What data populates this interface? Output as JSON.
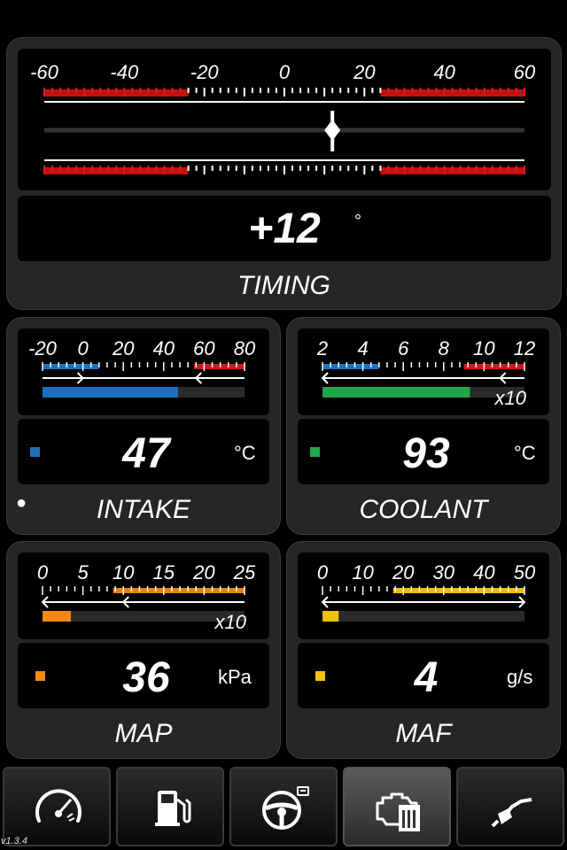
{
  "timing": {
    "title": "TIMING",
    "value": "+12",
    "unit": "°",
    "scale_labels": [
      "-60",
      "-40",
      "-20",
      "0",
      "20",
      "40",
      "60"
    ],
    "scale_min": -60,
    "scale_max": 60,
    "needle_value": 12
  },
  "intake": {
    "title": "INTAKE",
    "value": "47",
    "unit": "°C",
    "scale_labels": [
      "-20",
      "0",
      "20",
      "40",
      "60",
      "80"
    ],
    "scale_min": -20,
    "scale_max": 80,
    "bar_fill_fraction": 0.67,
    "bar_color": "#1f6fc0",
    "swatch_color": "#1f6fc0",
    "multiplier": ""
  },
  "coolant": {
    "title": "COOLANT",
    "value": "93",
    "unit": "°C",
    "scale_labels": [
      "2",
      "4",
      "6",
      "8",
      "10",
      "12"
    ],
    "multiplier": "x10",
    "bar_fill_fraction": 0.73,
    "bar_color": "#1ea84a",
    "swatch_color": "#1ea84a"
  },
  "map": {
    "title": "MAP",
    "value": "36",
    "unit": "kPa",
    "scale_labels": [
      "0",
      "5",
      "10",
      "15",
      "20",
      "25"
    ],
    "multiplier": "x10",
    "bar_fill_fraction": 0.14,
    "bar_color": "#f28a10",
    "swatch_color": "#f28a10"
  },
  "maf": {
    "title": "MAF",
    "value": "4",
    "unit": "g/s",
    "scale_labels": [
      "0",
      "10",
      "20",
      "30",
      "40",
      "50"
    ],
    "multiplier": "",
    "bar_fill_fraction": 0.08,
    "bar_color": "#f2c20a",
    "swatch_color": "#f2c20a"
  },
  "tabs": [
    {
      "icon": "speedometer-icon",
      "active": false
    },
    {
      "icon": "fuel-pump-icon",
      "active": false
    },
    {
      "icon": "steering-wheel-icon",
      "active": false
    },
    {
      "icon": "engine-icon",
      "active": true
    },
    {
      "icon": "fuel-nozzle-icon",
      "active": false
    }
  ],
  "version": "v1.3.4",
  "status_dot": "●"
}
